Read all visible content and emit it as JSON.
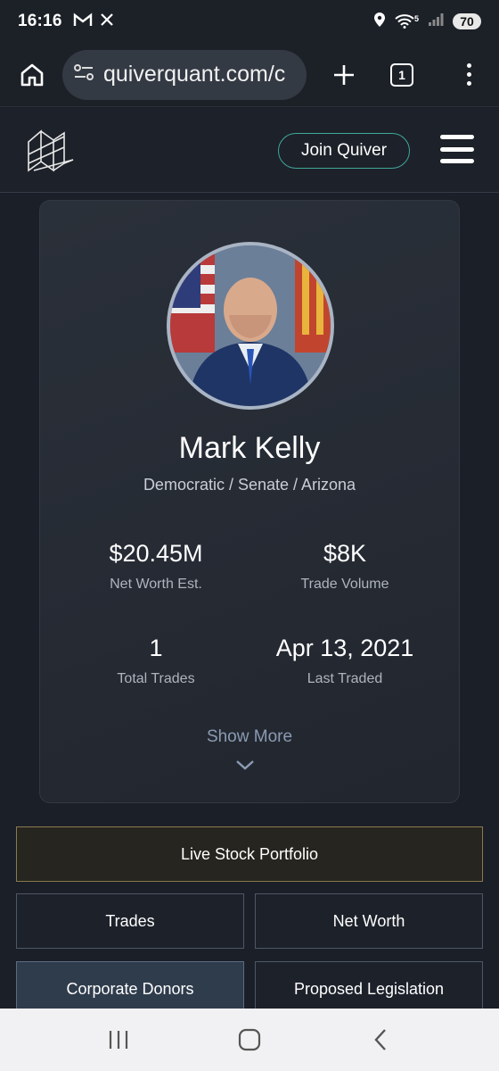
{
  "status_bar": {
    "time": "16:16",
    "left_icons": [
      "gmail-icon",
      "x-icon"
    ],
    "right_icons": [
      "location-icon",
      "wifi-icon",
      "signal-icon"
    ],
    "wifi_label": "5",
    "battery": "70"
  },
  "browser": {
    "url": "quiverquant.com/c",
    "tab_count": "1"
  },
  "site_header": {
    "join_label": "Join Quiver"
  },
  "profile": {
    "name": "Mark Kelly",
    "affiliation": "Democratic / Senate / Arizona",
    "stats": [
      {
        "value": "$20.45M",
        "label": "Net Worth Est."
      },
      {
        "value": "$8K",
        "label": "Trade Volume"
      },
      {
        "value": "1",
        "label": "Total Trades"
      },
      {
        "value": "Apr 13, 2021",
        "label": "Last Traded"
      }
    ],
    "show_more": "Show More"
  },
  "nav_buttons": {
    "portfolio": "Live Stock Portfolio",
    "trades": "Trades",
    "net_worth": "Net Worth",
    "corporate_donors": "Corporate Donors",
    "proposed_legislation": "Proposed Legislation"
  },
  "colors": {
    "background": "#1b1f27",
    "accent": "#3fa89a",
    "portfolio_border": "#8a7a4e",
    "muted_link": "#8a9bb3"
  }
}
